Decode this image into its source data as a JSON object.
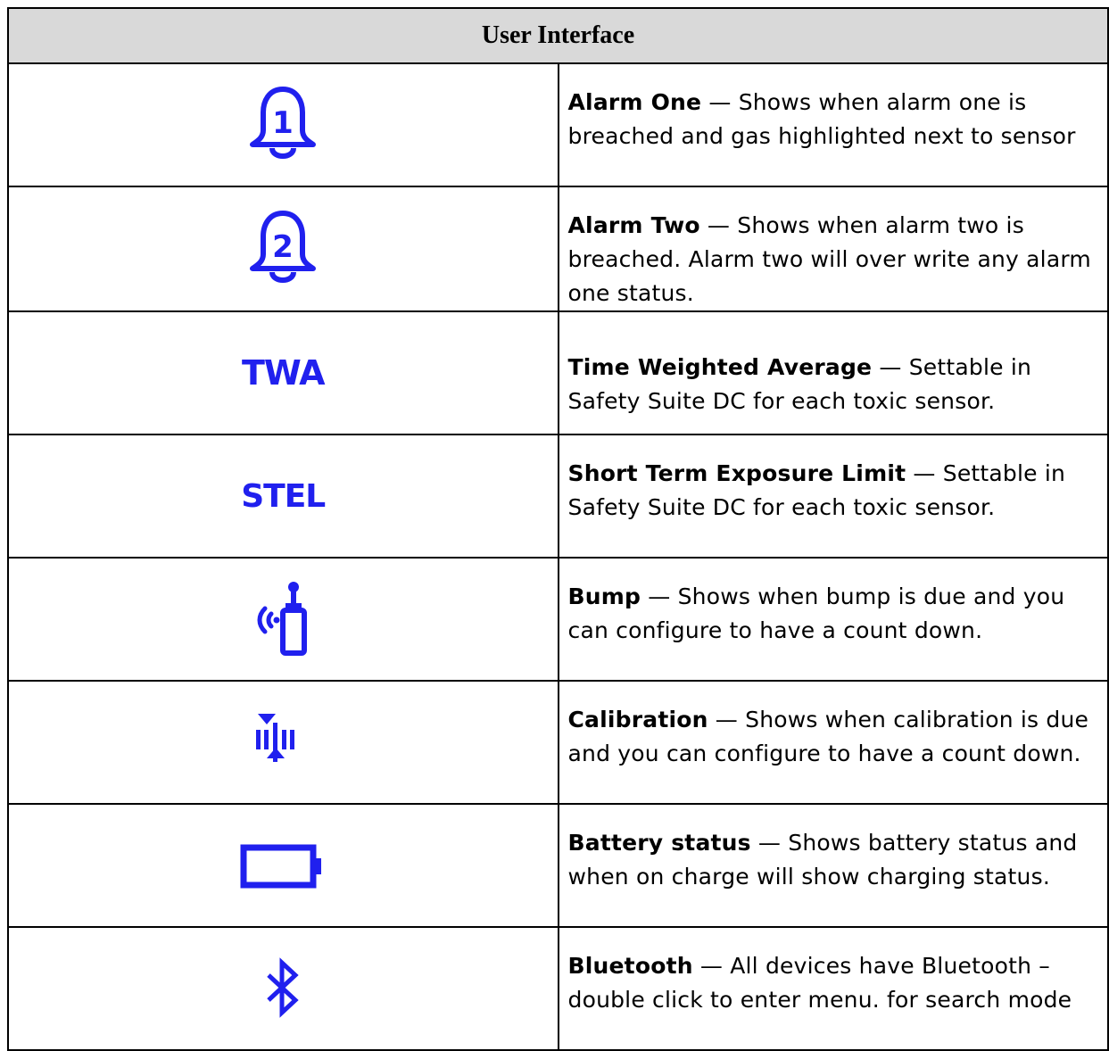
{
  "table": {
    "header": "User Interface",
    "icon_color": "#2020EE",
    "separator": " — ",
    "rows": [
      {
        "icon": "alarm-one-bell-icon",
        "term": "Alarm One",
        "description": "Shows when alarm one is breached and gas highlighted next to sensor"
      },
      {
        "icon": "alarm-two-bell-icon",
        "term": "Alarm Two",
        "description": "Shows when alarm two is breached. Alarm two will over write any alarm one status."
      },
      {
        "icon": "twa-icon",
        "icon_text": "TWA",
        "term": "Time Weighted Average",
        "description": "Settable in Safety Suite DC for each toxic sensor."
      },
      {
        "icon": "stel-icon",
        "icon_text": "STEL",
        "term": "Short Term Exposure Limit",
        "description": "Settable in Safety Suite DC for each toxic sensor."
      },
      {
        "icon": "bump-icon",
        "term": "Bump",
        "description": "Shows when bump is due and you can configure to have a count down."
      },
      {
        "icon": "calibration-icon",
        "term": "Calibration",
        "description": "Shows when calibration is due and you can configure to have a count down."
      },
      {
        "icon": "battery-icon",
        "term": "Battery status",
        "description": "Shows battery status and when on charge will show charging status."
      },
      {
        "icon": "bluetooth-icon",
        "term": "Bluetooth",
        "description": "All devices have Bluetooth – double click to enter menu. for search mode"
      }
    ]
  }
}
